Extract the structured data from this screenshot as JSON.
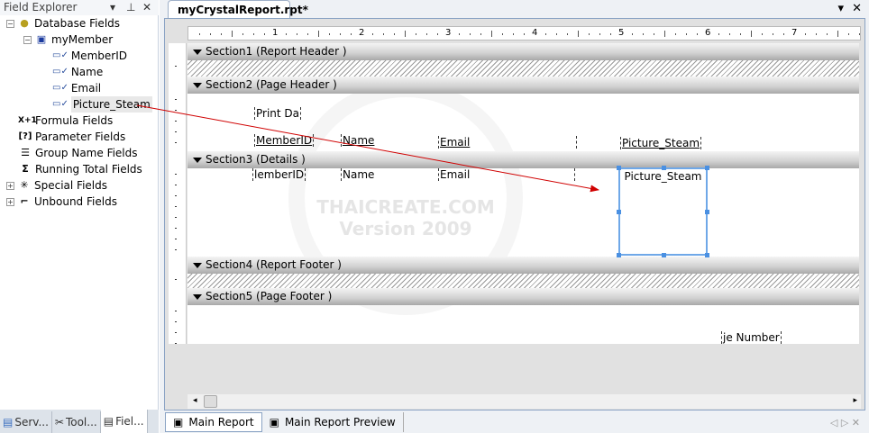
{
  "field_explorer": {
    "title": "Field Explorer",
    "tree": [
      {
        "label": "Database Fields",
        "icon": "database-icon",
        "expanded": true
      },
      {
        "label": "myMember",
        "icon": "table-icon",
        "expanded": true
      },
      {
        "label": "MemberID",
        "icon": "field-used-icon"
      },
      {
        "label": "Name",
        "icon": "field-used-icon"
      },
      {
        "label": "Email",
        "icon": "field-used-icon"
      },
      {
        "label": "Picture_Steam",
        "icon": "field-used-icon",
        "selected": true
      },
      {
        "label": "Formula Fields",
        "icon": "formula-icon",
        "icon_text": "X+1"
      },
      {
        "label": "Parameter Fields",
        "icon": "parameter-icon",
        "icon_text": "[?]"
      },
      {
        "label": "Group Name Fields",
        "icon": "group-icon"
      },
      {
        "label": "Running Total Fields",
        "icon": "sigma-icon",
        "icon_text": "Σ"
      },
      {
        "label": "Special Fields",
        "icon": "special-icon",
        "expanded": false
      },
      {
        "label": "Unbound Fields",
        "icon": "unbound-icon",
        "expanded": false
      }
    ],
    "bottom_tabs": [
      {
        "label": "Serv..."
      },
      {
        "label": "Tool..."
      },
      {
        "label": "Fiel..."
      }
    ]
  },
  "document": {
    "tab_title": "myCrystalReport.rpt*",
    "ruler": [
      "1",
      "2",
      "3",
      "4",
      "5",
      "6",
      "7"
    ],
    "sections": [
      {
        "label": "Section1 (Report Header  )"
      },
      {
        "label": "Section2 (Page Header  )"
      },
      {
        "label": "Section3 (Details  )"
      },
      {
        "label": "Section4 (Report Footer  )"
      },
      {
        "label": "Section5 (Page Footer  )"
      }
    ],
    "page_header_fields": {
      "print_date": "Print Da",
      "memberid": "MemberID",
      "name": "Name",
      "email": "Email",
      "picture": "Picture_Steam"
    },
    "detail_fields": {
      "memberid": "lemberID",
      "name": "Name",
      "email": "Email",
      "picture": "Picture_Steam"
    },
    "page_footer_fields": {
      "page_number": "je Number"
    },
    "watermark": "THAICREATE.COM Version 2009",
    "bottom_tabs": [
      {
        "label": "Main Report"
      },
      {
        "label": "Main Report Preview"
      }
    ]
  },
  "colors": {
    "selection": "#6fa8e8",
    "arrow": "#d00000"
  }
}
